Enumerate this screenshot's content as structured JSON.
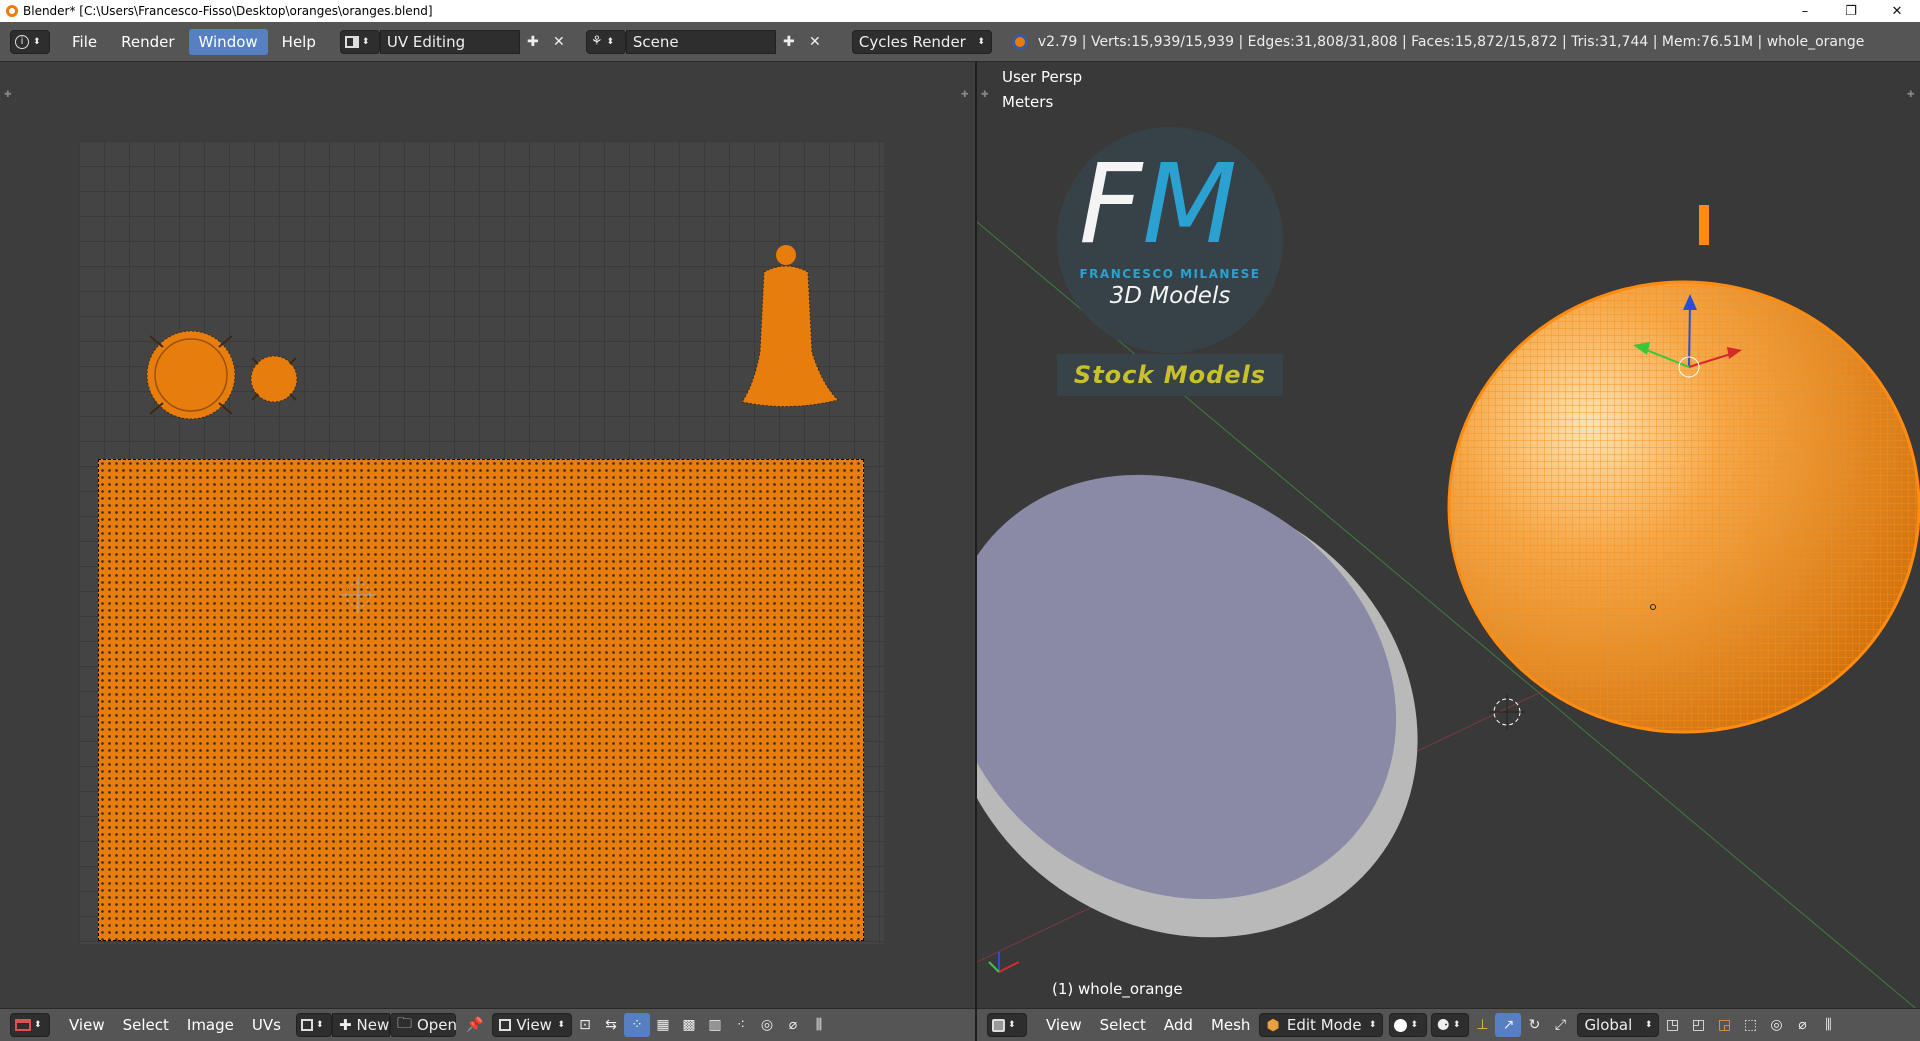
{
  "window": {
    "title": "Blender* [C:\\Users\\Francesco-Fisso\\Desktop\\oranges\\oranges.blend]",
    "controls": [
      "–",
      "❐",
      "✕"
    ]
  },
  "info_header": {
    "menu": [
      "File",
      "Render",
      "Window",
      "Help"
    ],
    "active_menu": "Window",
    "layout": "UV Editing",
    "scene": "Scene",
    "engine": "Cycles Render",
    "stats": "v2.79 | Verts:15,939/15,939 | Edges:31,808/31,808 | Faces:15,872/15,872 | Tris:31,744 | Mem:76.51M | whole_orange"
  },
  "uv_editor": {
    "menu": [
      "View",
      "Select",
      "Image",
      "UVs"
    ],
    "new_label": "New",
    "open_label": "Open",
    "view_label": "View"
  },
  "viewport": {
    "view_name": "User Persp",
    "units": "Meters",
    "object_label": "(1) whole_orange",
    "menu": [
      "View",
      "Select",
      "Add",
      "Mesh"
    ],
    "mode": "Edit Mode",
    "orientation": "Global",
    "logo": {
      "initials_f": "F",
      "initials_m": "M",
      "name": "FRANCESCO MILANESE",
      "subtitle": "3D Models",
      "badge": "Stock Models"
    }
  },
  "colors": {
    "accent_blue": "#5680c2",
    "orange": "#e77d0d",
    "logo_cyan": "#2aa7d9",
    "badge_yellow": "#c8c12c"
  }
}
